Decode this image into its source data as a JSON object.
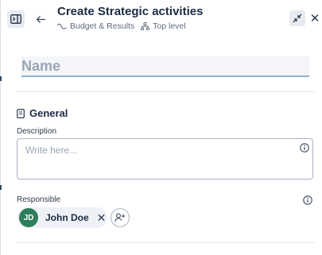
{
  "header": {
    "title": "Create Strategic activities",
    "breadcrumbs": [
      "Budget & Results",
      "Top level"
    ]
  },
  "name_field": {
    "placeholder": "Name"
  },
  "general": {
    "section_title": "General",
    "description_label": "Description",
    "description_placeholder": "Write here...",
    "responsible_label": "Responsible",
    "responsible": {
      "initials": "JD",
      "name": "John Doe"
    }
  },
  "colors": {
    "avatar": "#2e7d5b",
    "accent_underline": "#8fb0d0"
  },
  "icons": [
    "panel-toggle-icon",
    "back-arrow-icon",
    "trend-icon",
    "hierarchy-icon",
    "collapse-icon",
    "close-icon",
    "document-icon",
    "info-icon",
    "remove-icon",
    "add-person-icon"
  ]
}
